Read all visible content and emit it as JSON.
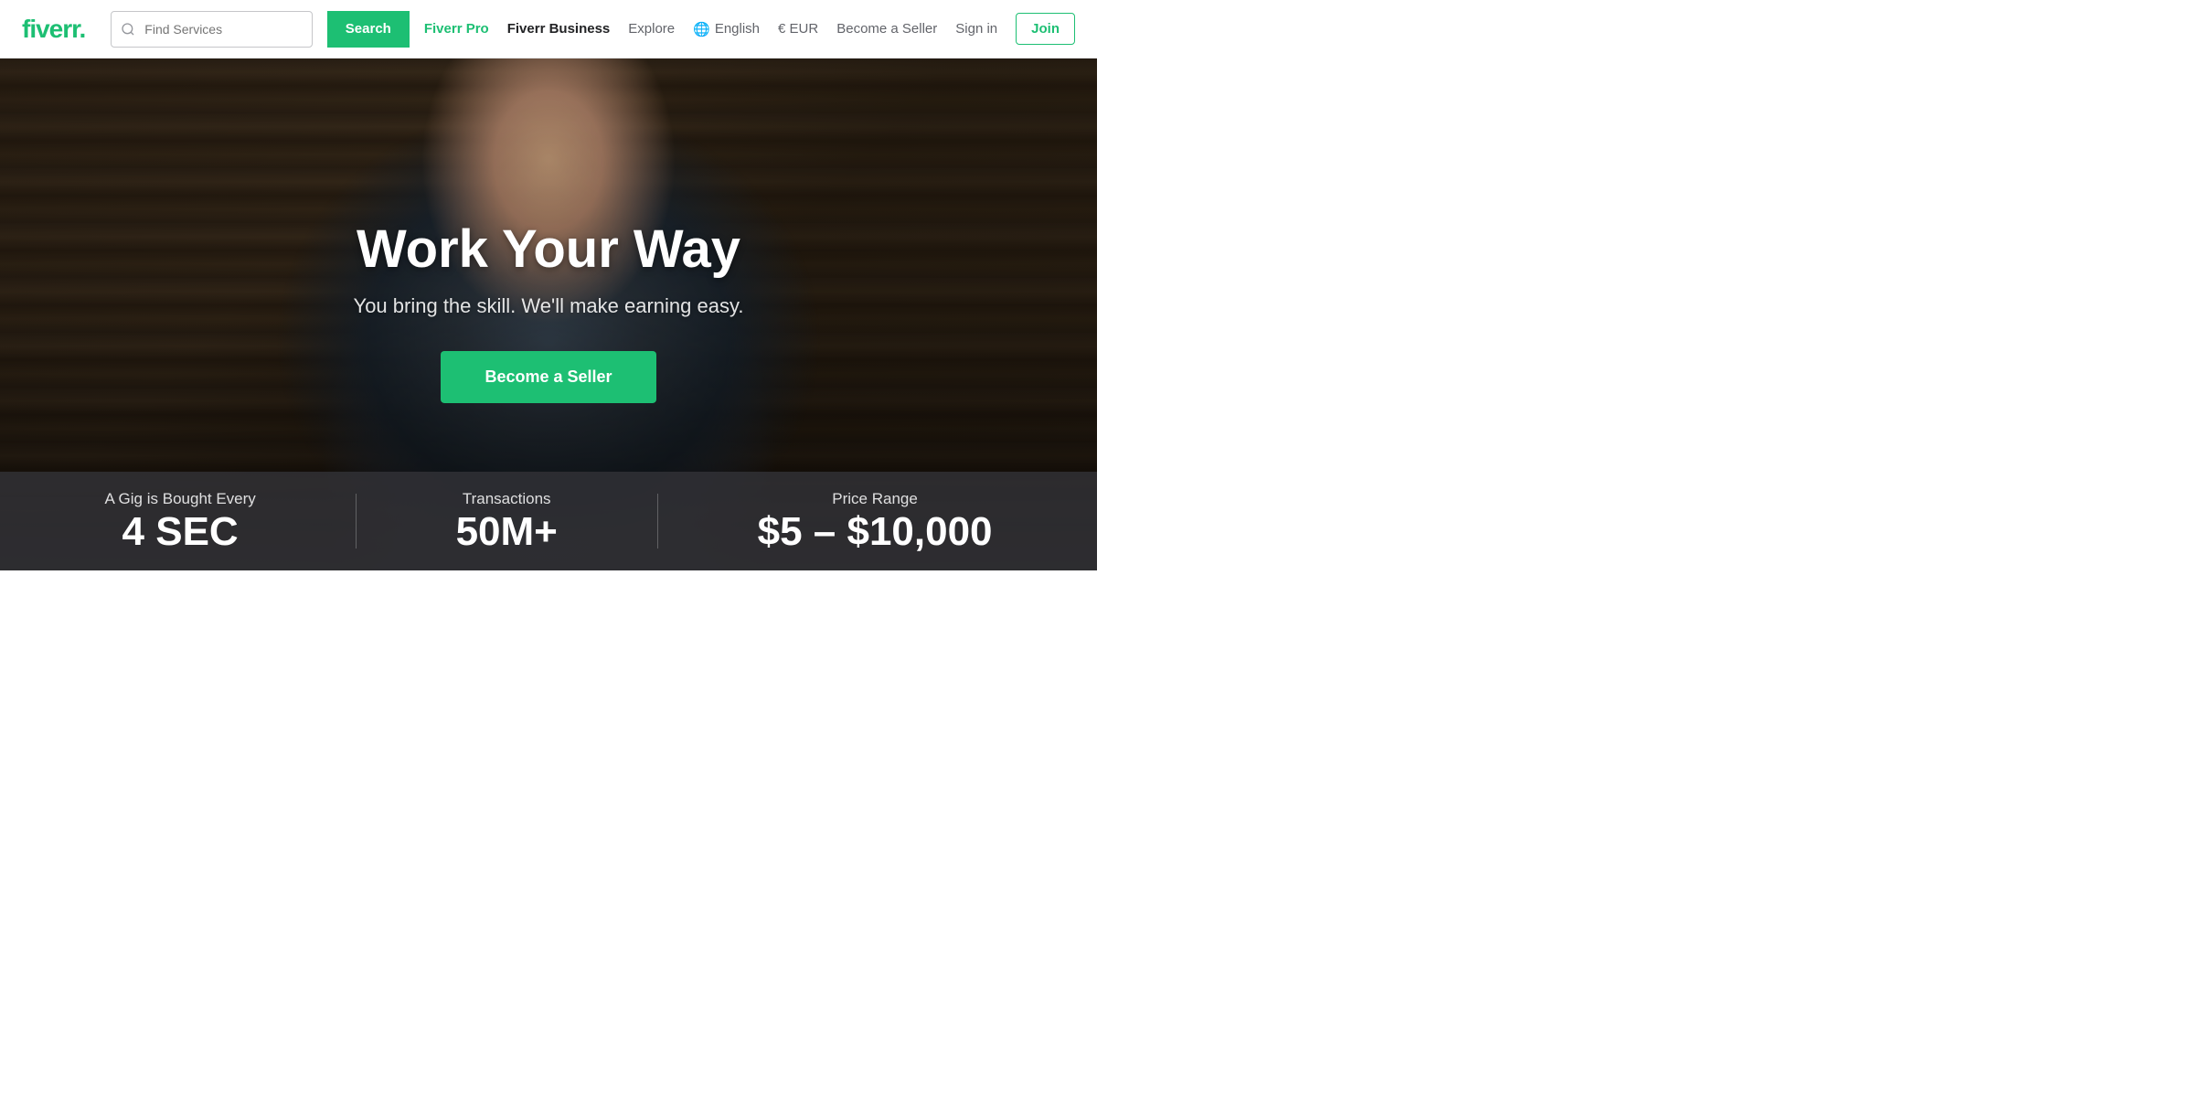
{
  "logo": {
    "text_main": "fiverr",
    "text_dot": "."
  },
  "search": {
    "placeholder": "Find Services",
    "button_label": "Search"
  },
  "nav": {
    "pro_label": "Fiverr Pro",
    "business_label": "Fiverr Business",
    "explore_label": "Explore",
    "lang_icon": "🌐",
    "lang_label": "English",
    "currency_label": "€ EUR",
    "become_seller_label": "Become a Seller",
    "signin_label": "Sign in",
    "join_label": "Join"
  },
  "hero": {
    "title": "Work Your Way",
    "subtitle": "You bring the skill. We'll make earning easy.",
    "cta_label": "Become a Seller"
  },
  "stats": [
    {
      "label": "A Gig is Bought Every",
      "value": "4 SEC"
    },
    {
      "label": "Transactions",
      "value": "50M+"
    },
    {
      "label": "Price Range",
      "value": "$5 – $10,000"
    }
  ]
}
